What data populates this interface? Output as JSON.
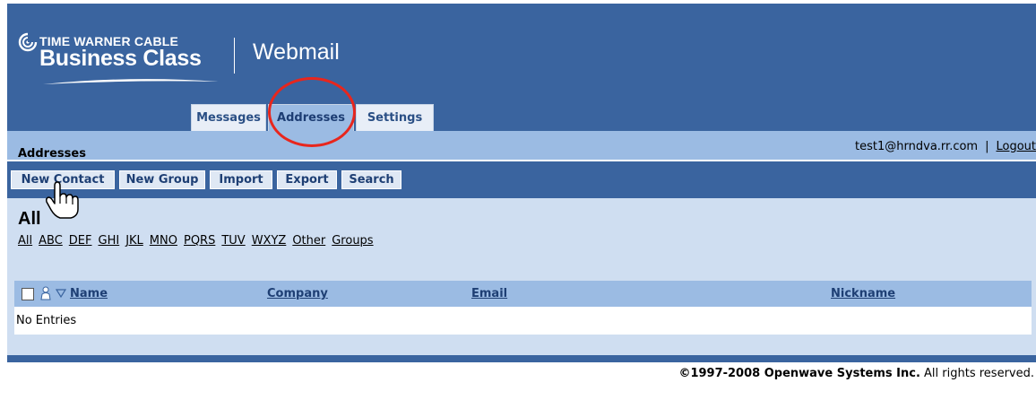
{
  "brand": {
    "top_line": "TIME WARNER CABLE",
    "business_line": "Business Class",
    "product": "Webmail"
  },
  "tabs": [
    {
      "label": "Messages",
      "active": false
    },
    {
      "label": "Addresses",
      "active": true
    },
    {
      "label": "Settings",
      "active": false
    }
  ],
  "section": {
    "title": "Addresses",
    "user_email": "test1@hrndva.rr.com",
    "separator": "|",
    "logout_label": "Logout"
  },
  "toolbar": {
    "new_contact": "New Contact",
    "new_group": "New Group",
    "import": "Import",
    "export": "Export",
    "search": "Search"
  },
  "filter": {
    "heading": "All",
    "links": [
      "All",
      "ABC",
      "DEF",
      "GHI",
      "JKL",
      "MNO",
      "PQRS",
      "TUV",
      "WXYZ",
      "Other",
      "Groups"
    ]
  },
  "table": {
    "columns": [
      "Name",
      "Company",
      "Email",
      "Nickname"
    ],
    "empty_text": "No Entries"
  },
  "footer": {
    "copyright": "©1997-2008 Openwave Systems Inc.",
    "rights": " All rights reserved."
  },
  "colors": {
    "header_blue": "#3a649f",
    "light_blue": "#9bbbe3",
    "panel_blue": "#cfdef1",
    "highlight_circle": "#e8261d"
  },
  "icons": [
    "twc-logo-icon",
    "person-icon",
    "sort-desc-icon",
    "hand-pointer-icon"
  ]
}
